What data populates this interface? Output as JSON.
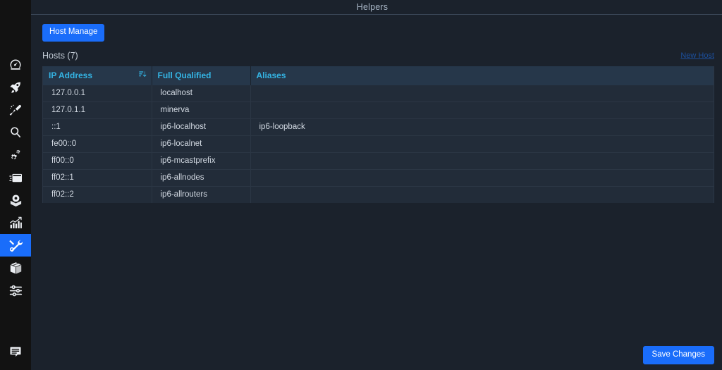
{
  "window": {
    "title": "Helpers"
  },
  "colors": {
    "accent_blue": "#1a6dfa",
    "link_blue": "#1c4f9c",
    "header_text_cyan": "#34b4e4",
    "sidebar_bg": "#121212",
    "main_bg": "#1b222c",
    "table_header_bg": "#26374a",
    "table_row_bg": "#222c39"
  },
  "sidebar": {
    "items": [
      {
        "name": "dashboard",
        "icon": "gauge-icon",
        "active": false
      },
      {
        "name": "boost",
        "icon": "rocket-icon",
        "active": false
      },
      {
        "name": "cleaner",
        "icon": "brush-icon",
        "active": false
      },
      {
        "name": "search",
        "icon": "magnifier-icon",
        "active": false
      },
      {
        "name": "settings",
        "icon": "gears-icon",
        "active": false
      },
      {
        "name": "windows",
        "icon": "window-icon",
        "active": false
      },
      {
        "name": "capture",
        "icon": "camera-box-icon",
        "active": false
      },
      {
        "name": "statistics",
        "icon": "bar-chart-icon",
        "active": false
      },
      {
        "name": "helpers",
        "icon": "tools-icon",
        "active": true
      },
      {
        "name": "packages",
        "icon": "box-icon",
        "active": false
      },
      {
        "name": "tweaks",
        "icon": "sliders-icon",
        "active": false
      }
    ],
    "bottom_item": {
      "name": "feedback",
      "icon": "chat-bubble-icon"
    }
  },
  "toolbar": {
    "host_manage_label": "Host Manage"
  },
  "hosts_section": {
    "title": "Hosts (7)",
    "new_host_label": "New Host"
  },
  "table": {
    "columns": [
      {
        "key": "ip",
        "label": "IP Address",
        "sort": "descending",
        "sort_icon": "sort-descending-icon"
      },
      {
        "key": "fq",
        "label": "Full Qualified",
        "sort": null
      },
      {
        "key": "al",
        "label": "Aliases",
        "sort": null
      }
    ],
    "rows": [
      {
        "ip": "127.0.0.1",
        "fq": "localhost",
        "al": ""
      },
      {
        "ip": "127.0.1.1",
        "fq": "minerva",
        "al": ""
      },
      {
        "ip": "::1",
        "fq": "ip6-localhost",
        "al": "ip6-loopback"
      },
      {
        "ip": "fe00::0",
        "fq": "ip6-localnet",
        "al": ""
      },
      {
        "ip": "ff00::0",
        "fq": "ip6-mcastprefix",
        "al": ""
      },
      {
        "ip": "ff02::1",
        "fq": "ip6-allnodes",
        "al": ""
      },
      {
        "ip": "ff02::2",
        "fq": "ip6-allrouters",
        "al": ""
      }
    ]
  },
  "footer": {
    "save_label": "Save Changes"
  }
}
